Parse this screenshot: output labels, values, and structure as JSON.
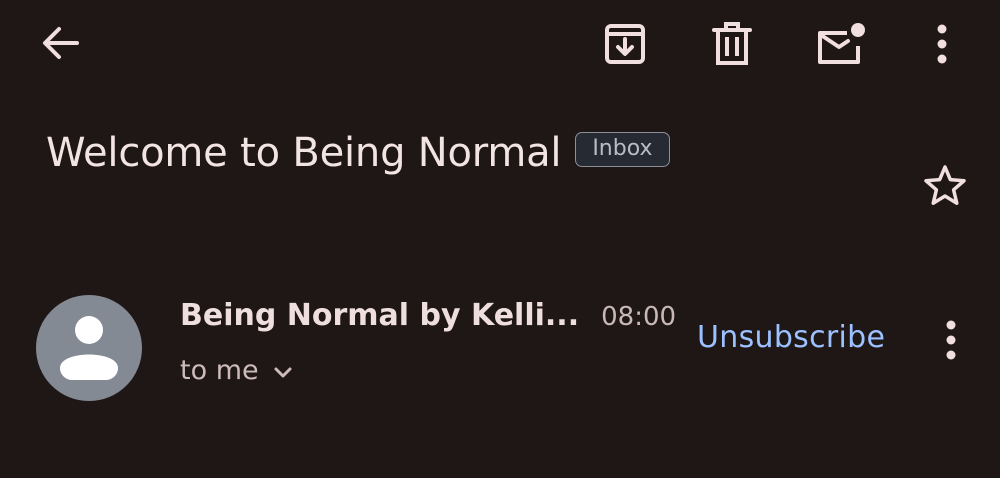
{
  "toolbar": {
    "back_icon": "arrow-left-icon",
    "archive_icon": "archive-icon",
    "delete_icon": "trash-icon",
    "mark_unread_icon": "mail-unread-icon",
    "overflow_icon": "more-vert-icon"
  },
  "email": {
    "subject": "Welcome to Being Normal",
    "label": "Inbox",
    "starred": false
  },
  "message": {
    "sender": "Being Normal by Kelli...",
    "time": "08:00",
    "recipient": "to me",
    "unsubscribe_label": "Unsubscribe"
  },
  "colors": {
    "background": "#1f1616",
    "text": "#f1dede",
    "accent_link": "#9cc1ff",
    "avatar_bg": "#838a93"
  }
}
